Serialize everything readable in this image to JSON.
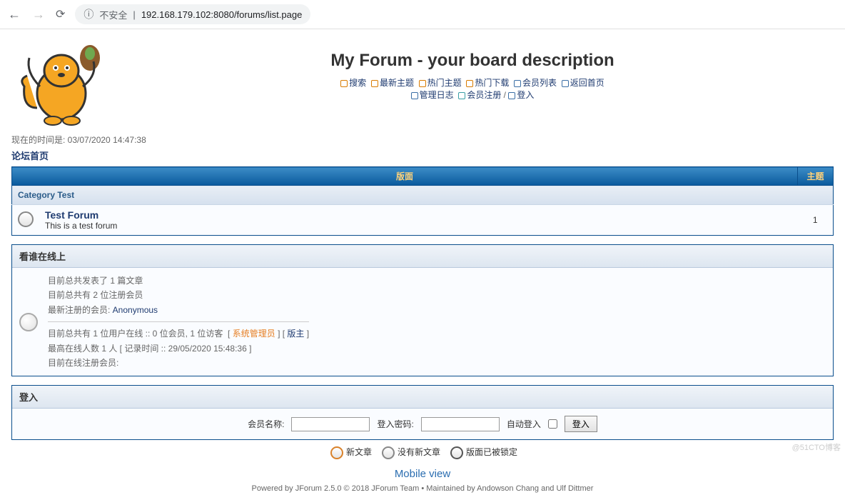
{
  "browser": {
    "security_label": "不安全",
    "url_display": "192.168.179.102:8080/forums/list.page"
  },
  "header": {
    "title": "My Forum - your board description",
    "nav": {
      "search": "搜索",
      "latest": "最新主题",
      "hot_topics": "热门主题",
      "hot_downloads": "热门下载",
      "members": "会员列表",
      "back_home": "返回首页",
      "admin_log": "管理日志",
      "register": "会员注册",
      "login": "登入"
    }
  },
  "time": {
    "label": "现在的时间是: ",
    "value": "03/07/2020 14:47:38"
  },
  "crumb": {
    "home": "论坛首页"
  },
  "table": {
    "col_forum": "版面",
    "col_topics": "主题",
    "category": "Category Test",
    "forums": [
      {
        "name": "Test Forum",
        "desc": "This is a test forum",
        "topics": "1"
      }
    ]
  },
  "who": {
    "title": "看谁在线上",
    "posts_prefix": "目前总共发表了 ",
    "posts_count": "1",
    "posts_suffix": " 篇文章",
    "members_prefix": "目前总共有 ",
    "members_count": "2",
    "members_suffix": " 位注册会员",
    "newest_label": "最新注册的会员: ",
    "newest_name": "Anonymous",
    "online_line": "目前总共有 1 位用户在线 :: 0 位会员, 1 位访客 ",
    "admin_label": "系统管理员",
    "mod_label": "版主",
    "max_line": "最高在线人数 1 人 [ 记录时间 :: 29/05/2020 15:48:36 ]",
    "online_members_label": "目前在线注册会员:"
  },
  "login": {
    "title": "登入",
    "username_label": "会员名称:",
    "password_label": "登入密码:",
    "auto_label": "自动登入",
    "button": "登入"
  },
  "legend": {
    "new": "新文章",
    "nonew": "没有新文章",
    "locked": "版面已被锁定"
  },
  "mobile": "Mobile view",
  "footer": "Powered by JForum 2.5.0 © 2018 JForum Team • Maintained by Andowson Chang and Ulf Dittmer",
  "watermark": "@51CTO博客"
}
